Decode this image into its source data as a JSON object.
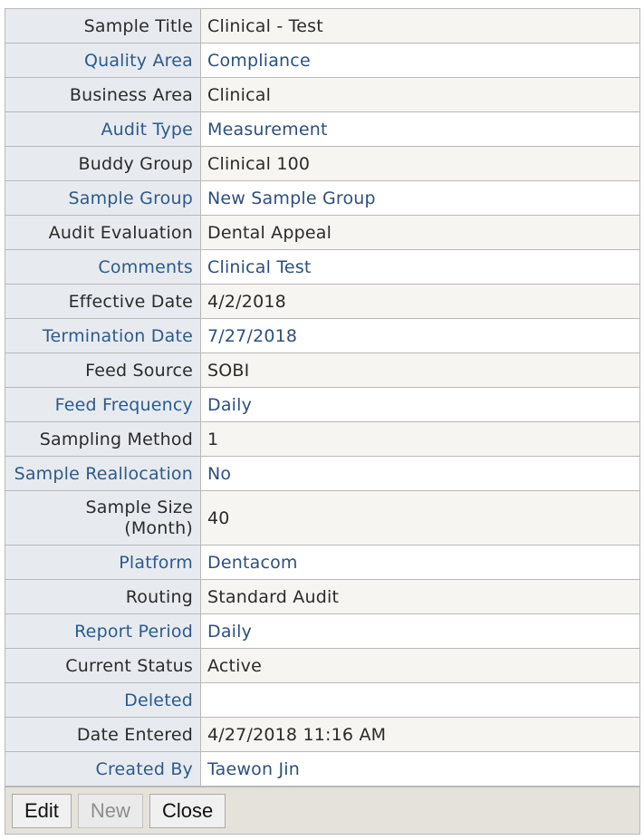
{
  "fields": [
    {
      "label": "Sample Title",
      "value": "Clinical - Test"
    },
    {
      "label": "Quality Area",
      "value": "Compliance"
    },
    {
      "label": "Business Area",
      "value": "Clinical"
    },
    {
      "label": "Audit Type",
      "value": "Measurement"
    },
    {
      "label": "Buddy Group",
      "value": "Clinical 100"
    },
    {
      "label": "Sample Group",
      "value": "New Sample Group"
    },
    {
      "label": "Audit Evaluation",
      "value": "Dental Appeal"
    },
    {
      "label": "Comments",
      "value": "Clinical Test"
    },
    {
      "label": "Effective Date",
      "value": "4/2/2018"
    },
    {
      "label": "Termination Date",
      "value": "7/27/2018"
    },
    {
      "label": "Feed Source",
      "value": "SOBI"
    },
    {
      "label": "Feed Frequency",
      "value": "Daily"
    },
    {
      "label": "Sampling Method",
      "value": "1"
    },
    {
      "label": "Sample Reallocation",
      "value": "No"
    },
    {
      "label": "Sample Size",
      "label_line2": "(Month)",
      "value": "40"
    },
    {
      "label": "Platform",
      "value": "Dentacom"
    },
    {
      "label": "Routing",
      "value": "Standard Audit"
    },
    {
      "label": "Report Period",
      "value": "Daily"
    },
    {
      "label": "Current Status",
      "value": "Active"
    },
    {
      "label": "Deleted",
      "value": ""
    },
    {
      "label": "Date Entered",
      "value": "4/27/2018 11:16 AM"
    },
    {
      "label": "Created By",
      "value": "Taewon Jin"
    }
  ],
  "buttons": {
    "edit": "Edit",
    "new": "New",
    "close": "Close"
  }
}
